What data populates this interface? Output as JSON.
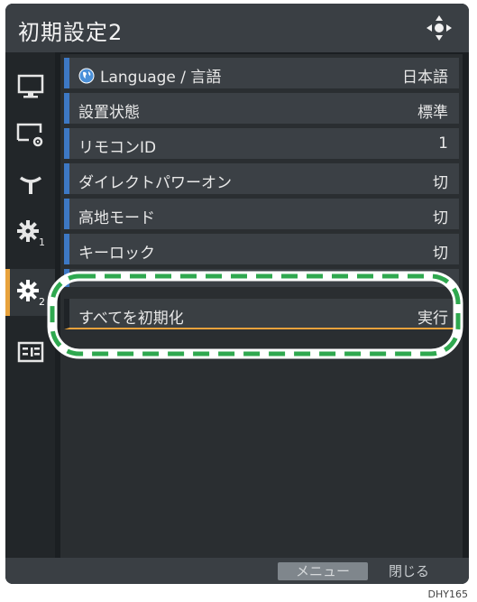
{
  "header": {
    "title": "初期設定2"
  },
  "rows": [
    {
      "label": "Language / 言語",
      "value": "日本語"
    },
    {
      "label": "設置状態",
      "value": "標準"
    },
    {
      "label": "リモコンID",
      "value": "1"
    },
    {
      "label": "ダイレクトパワーオン",
      "value": "切"
    },
    {
      "label": "高地モード",
      "value": "切"
    },
    {
      "label": "キーロック",
      "value": "切"
    }
  ],
  "selected_row": {
    "label": "すべてを初期化",
    "value": "実行"
  },
  "footer": {
    "menu_label": "メニュー",
    "close_label": "閉じる"
  },
  "figure_code": "DHY165",
  "colors": {
    "accent": "#e8a23c",
    "row_marker": "#3d78c4",
    "highlight": "#2fa84f"
  },
  "sidebar": {
    "items": [
      {
        "icon": "monitor-icon"
      },
      {
        "icon": "display-settings-icon"
      },
      {
        "icon": "antenna-icon"
      },
      {
        "icon": "gear-1-icon",
        "badge": "1"
      },
      {
        "icon": "gear-2-icon",
        "badge": "2",
        "active": true
      },
      {
        "icon": "info-panel-icon"
      }
    ]
  }
}
